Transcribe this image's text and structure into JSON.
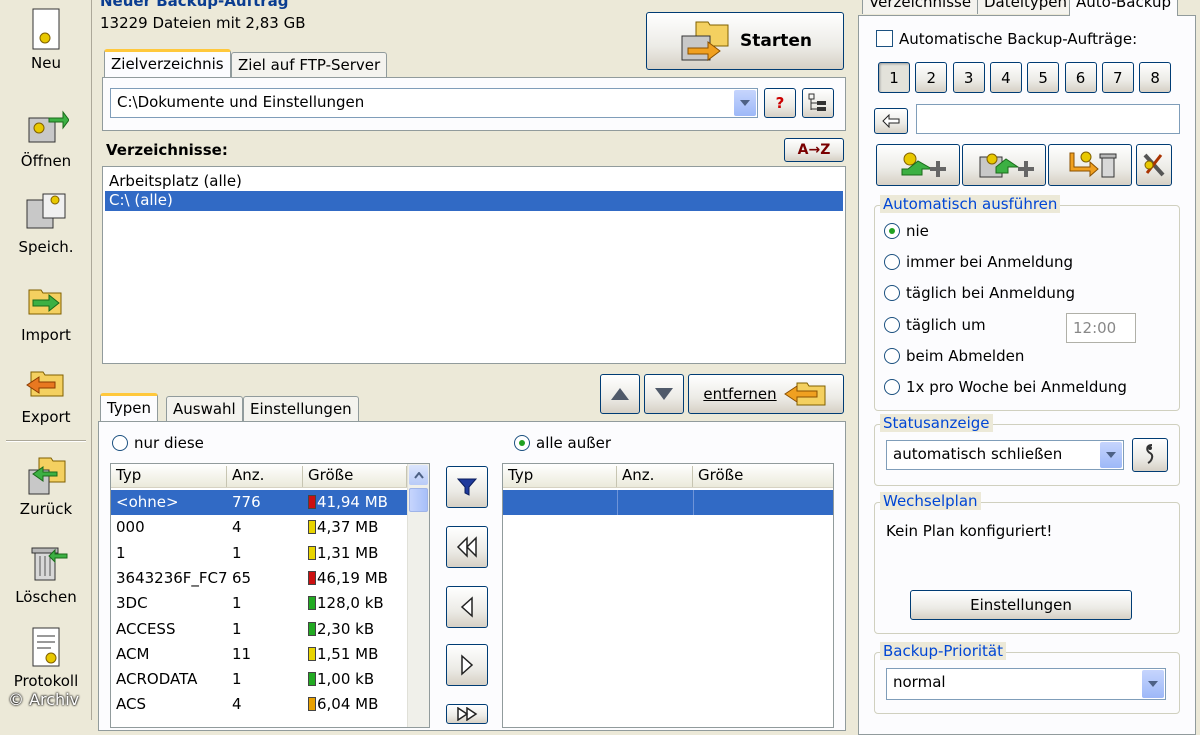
{
  "left_toolbar": [
    {
      "label": "Neu"
    },
    {
      "label": "Öffnen"
    },
    {
      "label": "Speich."
    },
    {
      "label": "Import"
    },
    {
      "label": "Export"
    },
    {
      "label": "Zurück"
    },
    {
      "label": "Löschen"
    },
    {
      "label": "Protokoll"
    }
  ],
  "job": {
    "title": "Neuer Backup-Auftrag",
    "summary": "13229 Dateien mit 2,83 GB",
    "start_label": "Starten"
  },
  "target_tabs": [
    "Zielverzeichnis",
    "Ziel auf FTP-Server"
  ],
  "target_path": "C:\\Dokumente und Einstellungen",
  "help_label": "?",
  "directories": {
    "heading": "Verzeichnisse:",
    "sort_label": "A→Z",
    "items": [
      "Arbeitsplatz (alle)",
      "C:\\ (alle)"
    ],
    "selected_index": 1
  },
  "bottom_tabs": [
    "Typen",
    "Auswahl",
    "Einstellungen"
  ],
  "remove_label": "entfernen",
  "filter": {
    "only_these": "nur diese",
    "all_except": "alle außer",
    "selected": "all_except"
  },
  "types_table": {
    "columns": [
      "Typ",
      "Anz.",
      "Größe"
    ],
    "rows": [
      {
        "type": "<ohne>",
        "count": "776",
        "size": "41,94 MB",
        "color": "#cc1010"
      },
      {
        "type": "000",
        "count": "4",
        "size": "4,37 MB",
        "color": "#e8d400"
      },
      {
        "type": "1",
        "count": "1",
        "size": "1,31 MB",
        "color": "#e8d400"
      },
      {
        "type": "3643236F_FC7",
        "count": "65",
        "size": "46,19 MB",
        "color": "#cc1010"
      },
      {
        "type": "3DC",
        "count": "1",
        "size": "128,0 kB",
        "color": "#22aa22"
      },
      {
        "type": "ACCESS",
        "count": "1",
        "size": "2,30 kB",
        "color": "#22aa22"
      },
      {
        "type": "ACM",
        "count": "11",
        "size": "1,51 MB",
        "color": "#e8d400"
      },
      {
        "type": "ACRODATA",
        "count": "1",
        "size": "1,00 kB",
        "color": "#22aa22"
      },
      {
        "type": "ACS",
        "count": "4",
        "size": "6,04 MB",
        "color": "#e8a000"
      }
    ],
    "selected_index": 0
  },
  "excluded_table": {
    "columns": [
      "Typ",
      "Anz.",
      "Größe"
    ]
  },
  "right_tabs": [
    "Verzeichnisse",
    "Dateitypen",
    "Auto-Backup"
  ],
  "auto_backup": {
    "checkbox_label": "Automatische Backup-Aufträge:",
    "slots": [
      "1",
      "2",
      "3",
      "4",
      "5",
      "6",
      "7",
      "8"
    ],
    "active_slot": 0,
    "name_value": "",
    "run_group_title": "Automatisch ausführen",
    "run_options": [
      "nie",
      "immer bei Anmeldung",
      "täglich bei Anmeldung",
      "täglich um",
      "beim Abmelden",
      "1x pro Woche bei Anmeldung"
    ],
    "run_selected": 0,
    "time_value": "12:00",
    "status_group_title": "Statusanzeige",
    "status_value": "automatisch schließen",
    "plan_group_title": "Wechselplan",
    "plan_text": "Kein Plan konfiguriert!",
    "plan_button": "Einstellungen",
    "priority_group_title": "Backup-Priorität",
    "priority_value": "normal"
  },
  "watermark": "© Archiv"
}
